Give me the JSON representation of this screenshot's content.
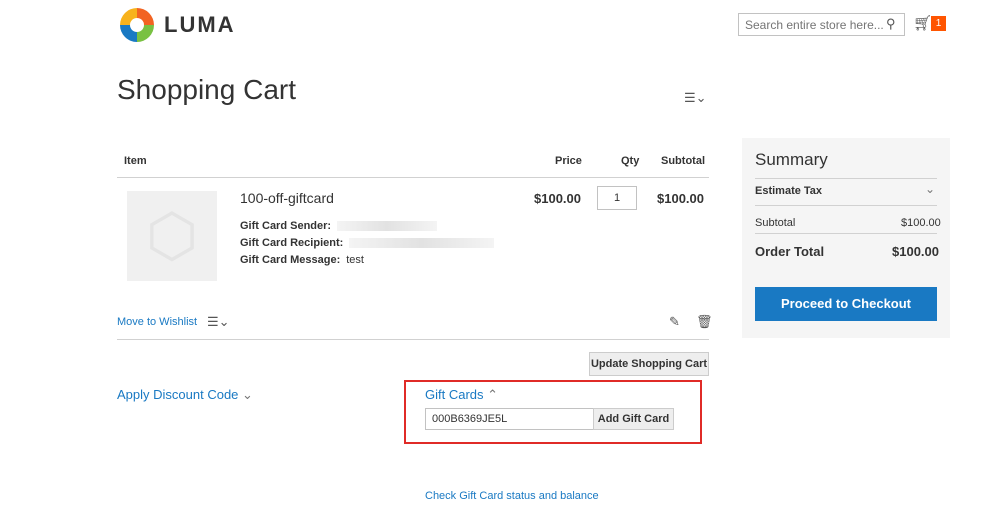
{
  "header": {
    "logo": "LUMA",
    "search_placeholder": "Search entire store here...",
    "cart_count": "1"
  },
  "page_title": "Shopping Cart",
  "table": {
    "headers": [
      "Item",
      "Price",
      "Qty",
      "Subtotal"
    ]
  },
  "item": {
    "name": "100-off-giftcard",
    "options": [
      {
        "label": "Gift Card Sender:",
        "value": ""
      },
      {
        "label": "Gift Card Recipient:",
        "value": ""
      },
      {
        "label": "Gift Card Message:",
        "value": "test"
      }
    ],
    "price": "$100.00",
    "qty": "1",
    "subtotal": "$100.00"
  },
  "actions": {
    "move_to_wishlist": "Move to Wishlist",
    "update_cart": "Update Shopping Cart"
  },
  "discount": {
    "label": "Apply Discount Code"
  },
  "gift_cards": {
    "label": "Gift Cards",
    "code": "000B6369JE5L",
    "add_button": "Add Gift Card",
    "check_link": "Check Gift Card status and balance"
  },
  "summary": {
    "title": "Summary",
    "estimate_tax": "Estimate Tax",
    "subtotal_label": "Subtotal",
    "subtotal": "$100.00",
    "order_total_label": "Order Total",
    "order_total": "$100.00",
    "checkout": "Proceed to Checkout"
  }
}
